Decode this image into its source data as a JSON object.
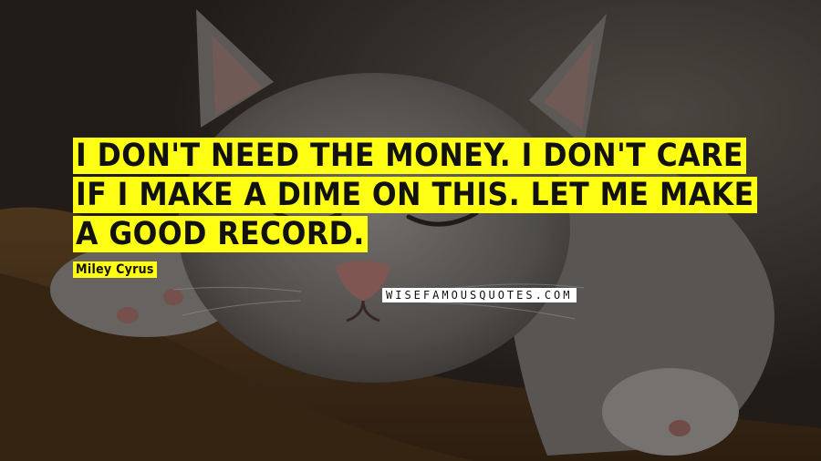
{
  "quote": {
    "text": "I don't need the money. I don't care if I make a dime on this. Let me make a good record."
  },
  "author": {
    "name": "Miley Cyrus"
  },
  "watermark": {
    "text": "WISEFAMOUSQUOTES.COM"
  },
  "colors": {
    "highlight": "#ffff14",
    "text": "#111111",
    "watermark_bg": "#ffffff"
  }
}
